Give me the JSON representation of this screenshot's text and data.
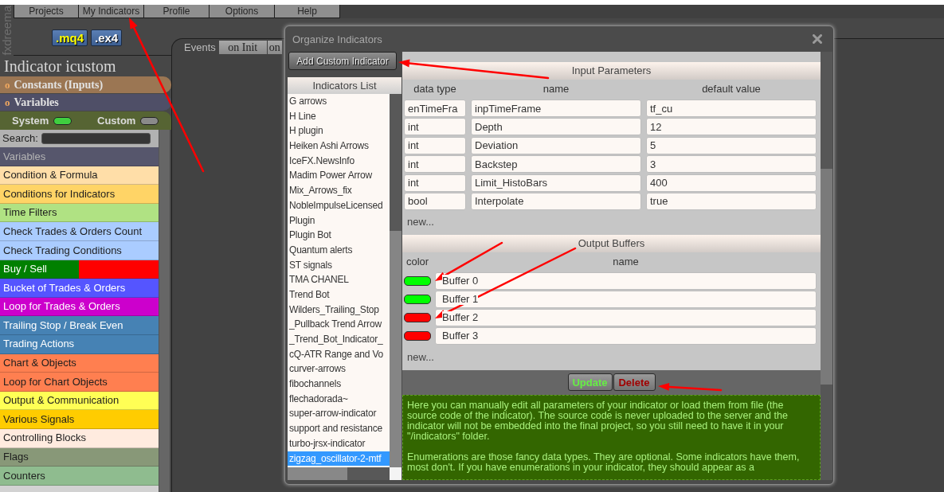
{
  "brand": "fxdreema",
  "menu": [
    "Projects",
    "My Indicators",
    "Profile",
    "Options",
    "Help"
  ],
  "file_buttons": [
    {
      "label": ".mq4",
      "kind": "source"
    },
    {
      "label": ".ex4",
      "kind": "compiled"
    }
  ],
  "events": {
    "label": "Events",
    "tabs": [
      "on Init",
      "on"
    ]
  },
  "sidebar": {
    "title": "Indicator icustom",
    "sections": [
      {
        "bullet": "o",
        "label": "Constants (Inputs)",
        "color": "#9b7653"
      },
      {
        "bullet": "o",
        "label": "Variables",
        "color": "#4f4f67"
      }
    ],
    "toggles": [
      {
        "label": "System",
        "on": true
      },
      {
        "label": "Custom",
        "on": false
      }
    ],
    "search": {
      "label": "Search:"
    },
    "categories": [
      {
        "label": "Variables",
        "kind": "heading",
        "color": "#56566c"
      },
      {
        "label": "Condition & Formula",
        "kind": "category",
        "color": "#ffdea8"
      },
      {
        "label": "Conditions for Indicators",
        "kind": "category",
        "color": "#ffd466"
      },
      {
        "label": "Time Filters",
        "kind": "category",
        "color": "#b0e283"
      },
      {
        "label": "Check Trades & Orders Count",
        "kind": "category",
        "color": "#aaccff"
      },
      {
        "label": "Check Trading Conditions",
        "kind": "category",
        "color": "#aaccff"
      },
      {
        "label": "Buy / Sell",
        "kind": "split",
        "color": "#008000",
        "second_half": {
          "color": "#ff0000"
        }
      },
      {
        "label": "Bucket of Trades & Orders",
        "kind": "category",
        "color": "#5555ff"
      },
      {
        "label": "Loop for Trades & Orders",
        "kind": "category",
        "color": "#cc00cc"
      },
      {
        "label": "Trailing Stop / Break Even",
        "kind": "category",
        "color": "#4682b4"
      },
      {
        "label": "Trading Actions",
        "kind": "category",
        "color": "#4682b4"
      },
      {
        "label": "Chart & Objects",
        "kind": "category",
        "color": "#ff7f50"
      },
      {
        "label": "Loop for Chart Objects",
        "kind": "category",
        "color": "#ff7f50"
      },
      {
        "label": "Output & Communication",
        "kind": "category",
        "color": "#ffff55"
      },
      {
        "label": "Various Signals",
        "kind": "category",
        "color": "#ffcc00"
      },
      {
        "label": "Controlling Blocks",
        "kind": "category",
        "color": "#ffebdf"
      },
      {
        "label": "Flags",
        "kind": "category",
        "color": "#889878"
      },
      {
        "label": "Counters",
        "kind": "category",
        "color": "#8fbc8f"
      }
    ]
  },
  "dialog": {
    "title": "Organize Indicators",
    "add_button": "Add Custom Indicator",
    "list": {
      "title": "Indicators List",
      "items": [
        {
          "label": "G arrows",
          "selected": false
        },
        {
          "label": "H Line",
          "selected": false
        },
        {
          "label": "H plugin",
          "selected": false
        },
        {
          "label": "Heiken Ashi Arrows",
          "selected": false
        },
        {
          "label": "IceFX.NewsInfo",
          "selected": false
        },
        {
          "label": "Madim Power Arrow",
          "selected": false
        },
        {
          "label": "Mix_Arrows_fix",
          "selected": false
        },
        {
          "label": "NobleImpulseLicensed",
          "selected": false
        },
        {
          "label": "Plugin",
          "selected": false
        },
        {
          "label": "Plugin Bot",
          "selected": false
        },
        {
          "label": "Quantum alerts",
          "selected": false
        },
        {
          "label": "ST signals",
          "selected": false
        },
        {
          "label": "TMA CHANEL",
          "selected": false
        },
        {
          "label": "Trend Bot",
          "selected": false
        },
        {
          "label": "Wilders_Trailing_Stop",
          "selected": false
        },
        {
          "label": "_Pullback Trend Arrow",
          "selected": false
        },
        {
          "label": "_Trend_Bot_Indicator_",
          "selected": false
        },
        {
          "label": "cQ-ATR Range and Vo",
          "selected": false
        },
        {
          "label": "curver-arrows",
          "selected": false
        },
        {
          "label": "fibochannels",
          "selected": false
        },
        {
          "label": "flechadorada~",
          "selected": false
        },
        {
          "label": "super-arrow-indicator",
          "selected": false
        },
        {
          "label": "support and resistance",
          "selected": false
        },
        {
          "label": "turbo-jrsx-indicator",
          "selected": false
        },
        {
          "label": "zigzag_oscillator-2-mtf",
          "selected": true
        }
      ]
    },
    "inputs": {
      "title": "Input Parameters",
      "columns": [
        "data type",
        "name",
        "default value"
      ],
      "rows": [
        {
          "data_type": "enTimeFra",
          "name": "inpTimeFrame",
          "default_value": "tf_cu"
        },
        {
          "data_type": "int",
          "name": "Depth",
          "default_value": "12"
        },
        {
          "data_type": "int",
          "name": "Deviation",
          "default_value": "5"
        },
        {
          "data_type": "int",
          "name": "Backstep",
          "default_value": "3"
        },
        {
          "data_type": "int",
          "name": "Limit_HistoBars",
          "default_value": "400"
        },
        {
          "data_type": "bool",
          "name": "Interpolate",
          "default_value": "true"
        }
      ],
      "new_link": "new..."
    },
    "buffers": {
      "title": "Output Buffers",
      "columns": [
        "color",
        "name"
      ],
      "rows": [
        {
          "color": "#00ff00",
          "name": "Buffer 0"
        },
        {
          "color": "#00ff00",
          "name": "Buffer 1"
        },
        {
          "color": "#ff0000",
          "name": "Buffer 2"
        },
        {
          "color": "#ff0000",
          "name": "Buffer 3"
        }
      ],
      "new_link": "new..."
    },
    "buttons": [
      {
        "label": "Update",
        "kind": "update"
      },
      {
        "label": "Delete",
        "kind": "delete"
      }
    ],
    "help": [
      "Here you can manually edit all parameters of your indicator or load them from file (the source code of the indicator). The source code is never uploaded to the server and the indicator will not be embedded into the final project, so you still need to have it in your \"/indicators\" folder.",
      "Enumerations are those fancy data types. They are optional. Some indicators have them, most don't. If you have enumerations in your indicator, they should appear as a"
    ]
  }
}
